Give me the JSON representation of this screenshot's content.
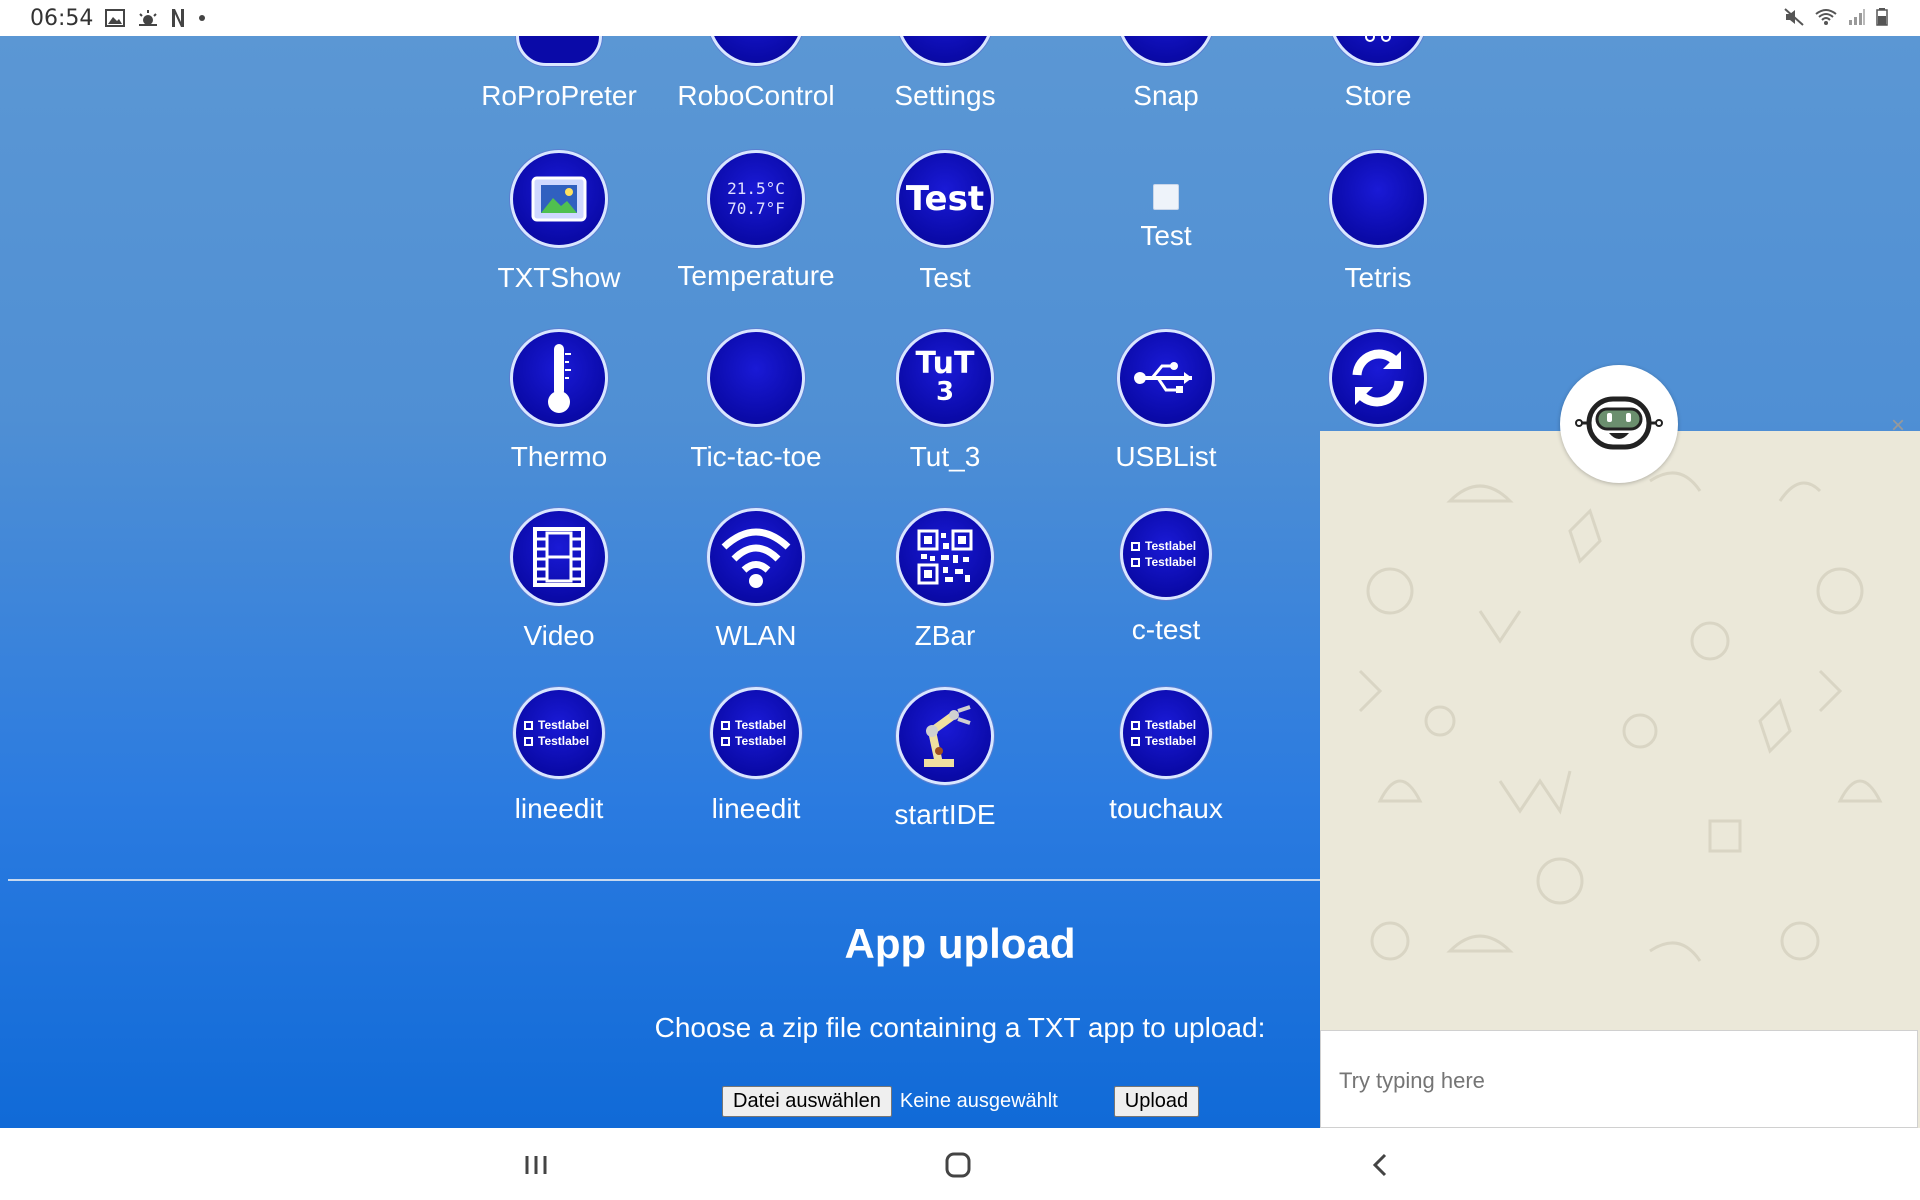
{
  "status_bar": {
    "time": "06:54"
  },
  "apps": [
    {
      "label": "RoProPreter",
      "icon": "ropropreter-icon"
    },
    {
      "label": "RoboControl",
      "icon": "robocontrol-icon"
    },
    {
      "label": "Settings",
      "icon": "gear-icon"
    },
    {
      "label": "Snap",
      "icon": "snap-icon"
    },
    {
      "label": "Store",
      "icon": "store-icon"
    },
    {
      "label": "TXTShow",
      "icon": "picture-frame-icon"
    },
    {
      "label": "Temperature",
      "icon": "temperature-readout-icon",
      "icon_text_1": "21.5°C",
      "icon_text_2": "70.7°F"
    },
    {
      "label": "Test",
      "icon": "test-text-icon",
      "icon_text": "Test"
    },
    {
      "label": "Test",
      "icon": "broken-image-icon"
    },
    {
      "label": "Tetris",
      "icon": "blank-circle-icon"
    },
    {
      "label": "Thermo",
      "icon": "thermometer-icon"
    },
    {
      "label": "Tic-tac-toe",
      "icon": "blank-circle-icon"
    },
    {
      "label": "Tut_3",
      "icon": "tut3-icon",
      "icon_text_1": "TuT",
      "icon_text_2": "3"
    },
    {
      "label": "USBList",
      "icon": "usb-icon"
    },
    {
      "label": "",
      "icon": "refresh-icon"
    },
    {
      "label": "Video",
      "icon": "film-strip-icon"
    },
    {
      "label": "WLAN",
      "icon": "wifi-icon"
    },
    {
      "label": "ZBar",
      "icon": "qr-code-icon"
    },
    {
      "label": "c-test",
      "icon": "checkbox-label-icon",
      "icon_text_1": "Testlabel",
      "icon_text_2": "Testlabel"
    },
    {
      "label": "lineedit",
      "icon": "checkbox-label-icon",
      "icon_text_1": "Testlabel",
      "icon_text_2": "Testlabel"
    },
    {
      "label": "lineedit",
      "icon": "checkbox-label-icon",
      "icon_text_1": "Testlabel",
      "icon_text_2": "Testlabel"
    },
    {
      "label": "startIDE",
      "icon": "robot-arm-icon"
    },
    {
      "label": "touchaux",
      "icon": "checkbox-label-icon",
      "icon_text_1": "Testlabel",
      "icon_text_2": "Testlabel"
    }
  ],
  "upload": {
    "title": "App upload",
    "description": "Choose a zip file containing a TXT app to upload:",
    "choose_button": "Datei auswählen",
    "no_file": "Keine ausgewählt",
    "upload_button": "Upload"
  },
  "chat": {
    "placeholder": "Try typing here",
    "close": "×",
    "background_color": "#ebe8d9"
  },
  "colors": {
    "icon_fill": "#0a0aa8",
    "page_top": "#5b97d4",
    "page_bottom": "#106ad7"
  }
}
